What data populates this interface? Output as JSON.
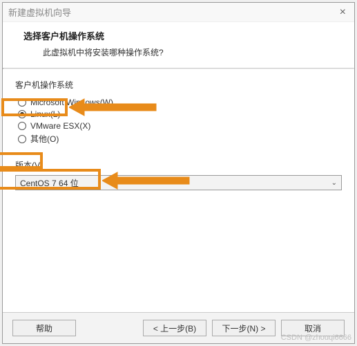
{
  "window": {
    "title": "新建虚拟机向导"
  },
  "header": {
    "title": "选择客户机操作系统",
    "subtitle": "此虚拟机中将安装哪种操作系统?"
  },
  "os_group": {
    "label": "客户机操作系统",
    "options": {
      "windows": "Microsoft Windows(W)",
      "linux": "Linux(L)",
      "esx": "VMware ESX(X)",
      "other": "其他(O)"
    },
    "selected": "linux"
  },
  "version": {
    "label": "版本(V)",
    "selected": "CentOS 7 64 位"
  },
  "buttons": {
    "help": "帮助",
    "back": "< 上一步(B)",
    "next": "下一步(N) >",
    "cancel": "取消"
  },
  "watermark": "CSDN @zhouqi6666"
}
